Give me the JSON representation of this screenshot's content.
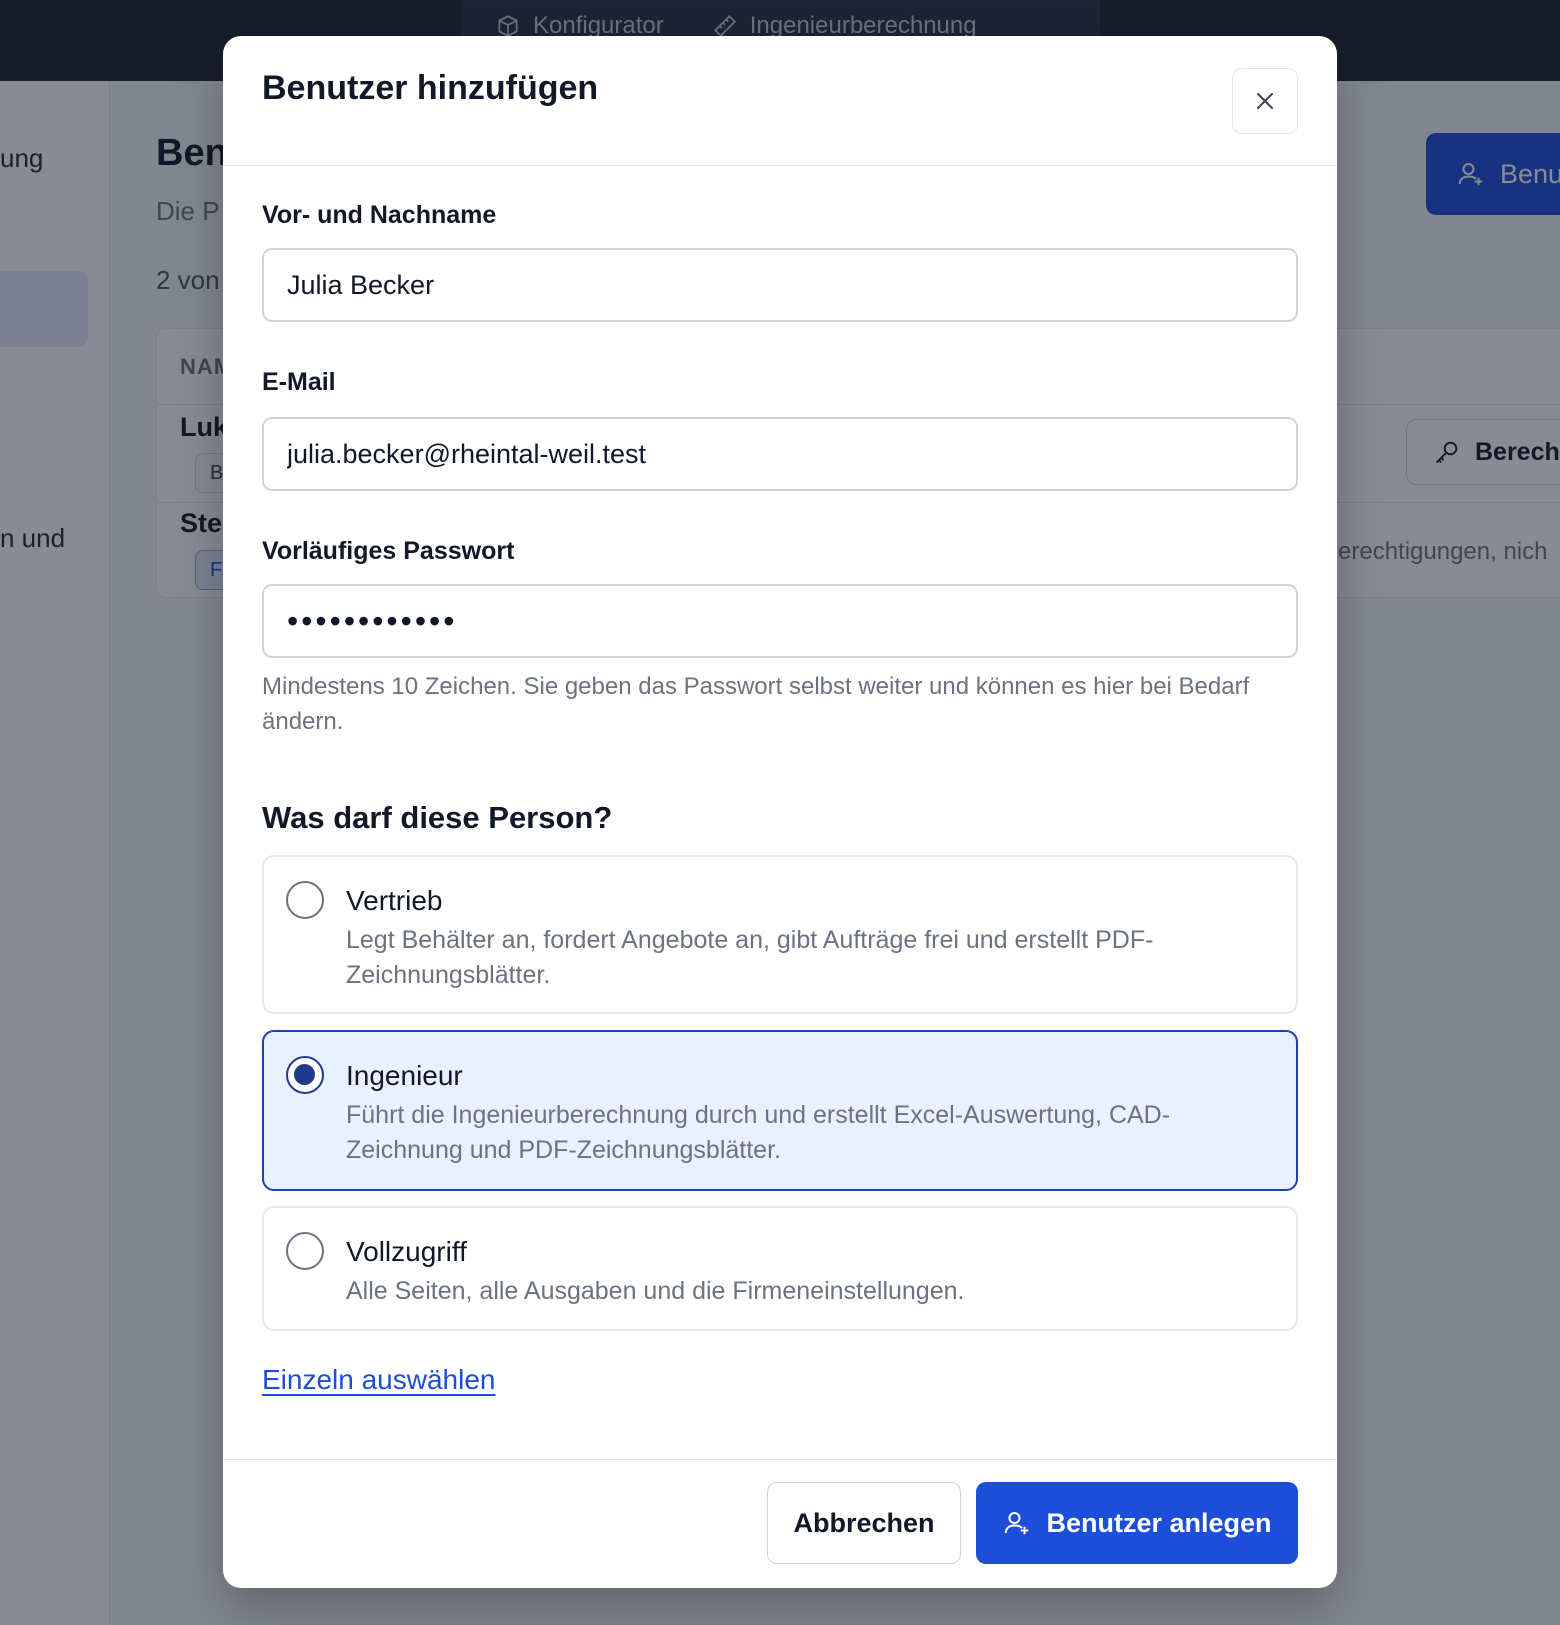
{
  "topnav": {
    "items": [
      {
        "label": "Konfigurator",
        "icon": "cube-icon"
      },
      {
        "label": "Ingenieurberechnung",
        "icon": "ruler-icon"
      }
    ]
  },
  "background": {
    "sidebar_fragments": [
      "ung",
      "n und"
    ],
    "page_title_fragment": "Ben",
    "page_subtitle_fragment": "Die P",
    "count_fragment": "2 von",
    "table_header_fragment": "NAM",
    "row1_name_fragment": "Luk",
    "row1_badge_fragment": "B",
    "row2_name_fragment": "Ste",
    "row2_badge_fragment": "F",
    "primary_button_fragment": "Benu",
    "permissions_button_fragment": "Berecht",
    "row2_text_fragment": "erechtigungen, nich"
  },
  "modal": {
    "title": "Benutzer hinzufügen",
    "fields": {
      "name": {
        "label": "Vor- und Nachname",
        "value": "Julia Becker"
      },
      "email": {
        "label": "E-Mail",
        "value": "julia.becker@rheintal-weil.test"
      },
      "password": {
        "label": "Vorläufiges Passwort",
        "value": "••••••••••••",
        "help": "Mindestens 10 Zeichen. Sie geben das Passwort selbst weiter und können es hier bei Bedarf ändern."
      }
    },
    "roles_title": "Was darf diese Person?",
    "roles": [
      {
        "title": "Vertrieb",
        "description": "Legt Behälter an, fordert Angebote an, gibt Aufträge frei und erstellt PDF-Zeichnungsblätter.",
        "selected": false
      },
      {
        "title": "Ingenieur",
        "description": "Führt die Ingenieurberechnung durch und erstellt Excel-Auswertung, CAD-Zeichnung und PDF-Zeichnungsblätter.",
        "selected": true
      },
      {
        "title": "Vollzugriff",
        "description": "Alle Seiten, alle Ausgaben und die Firmeneinstellungen.",
        "selected": false
      }
    ],
    "custom_link": "Einzeln auswählen",
    "cancel_label": "Abbrechen",
    "submit_label": "Benutzer anlegen"
  },
  "colors": {
    "accent": "#1d4ed8",
    "selected_bg": "#eaf1fe",
    "selected_border": "#1e40af",
    "topbar": "#1e2230"
  }
}
